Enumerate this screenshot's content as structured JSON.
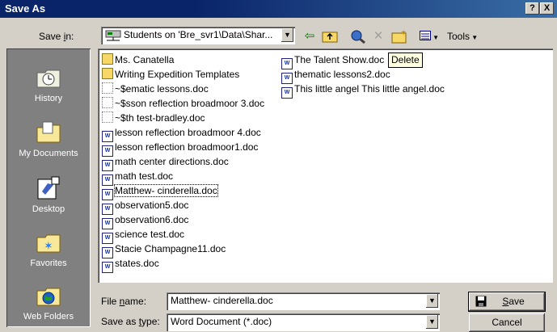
{
  "window": {
    "title": "Save As",
    "help_label": "?",
    "close_label": "X"
  },
  "save_in": {
    "label_pre": "Save ",
    "label_key": "i",
    "label_post": "n:",
    "value": "Students on 'Bre_svr1\\Data\\Shar..."
  },
  "toolbar": {
    "tools_label": "Tools",
    "tools_underline": "l"
  },
  "places": [
    {
      "label": "History",
      "icon": "history-icon"
    },
    {
      "label": "My Documents",
      "icon": "my-documents-icon"
    },
    {
      "label": "Desktop",
      "icon": "desktop-icon"
    },
    {
      "label": "Favorites",
      "icon": "favorites-icon"
    },
    {
      "label": "Web Folders",
      "icon": "web-folders-icon"
    }
  ],
  "files_col1": [
    {
      "name": "Ms. Canatella",
      "type": "folder"
    },
    {
      "name": "Writing Expedition Templates",
      "type": "folder"
    },
    {
      "name": "~$ematic lessons.doc",
      "type": "tmp"
    },
    {
      "name": "~$sson reflection broadmoor 3.doc",
      "type": "tmp"
    },
    {
      "name": "~$th test-bradley.doc",
      "type": "tmp"
    },
    {
      "name": "lesson reflection broadmoor 4.doc",
      "type": "doc"
    },
    {
      "name": "lesson reflection broadmoor1.doc",
      "type": "doc"
    },
    {
      "name": "math center directions.doc",
      "type": "doc"
    },
    {
      "name": "math test.doc",
      "type": "doc"
    },
    {
      "name": "Matthew- cinderella.doc",
      "type": "doc",
      "selected": true
    },
    {
      "name": "observation5.doc",
      "type": "doc"
    },
    {
      "name": "observation6.doc",
      "type": "doc"
    },
    {
      "name": "science test.doc",
      "type": "doc"
    },
    {
      "name": "Stacie Champagne11.doc",
      "type": "doc"
    },
    {
      "name": "states.doc",
      "type": "doc"
    }
  ],
  "files_col2": [
    {
      "name": "The Talent Show.doc",
      "type": "doc"
    },
    {
      "name": "thematic lessons2.doc",
      "type": "doc"
    },
    {
      "name": "This little angel This little angel.doc",
      "type": "doc"
    }
  ],
  "tooltip": "Delete",
  "file_name": {
    "label_pre": "File ",
    "label_key": "n",
    "label_post": "ame:",
    "value": "Matthew- cinderella.doc"
  },
  "save_as_type": {
    "label_pre": "Save as ",
    "label_key": "t",
    "label_post": "ype:",
    "value": "Word Document (*.doc)"
  },
  "buttons": {
    "save_key": "S",
    "save_rest": "ave",
    "cancel": "Cancel"
  }
}
